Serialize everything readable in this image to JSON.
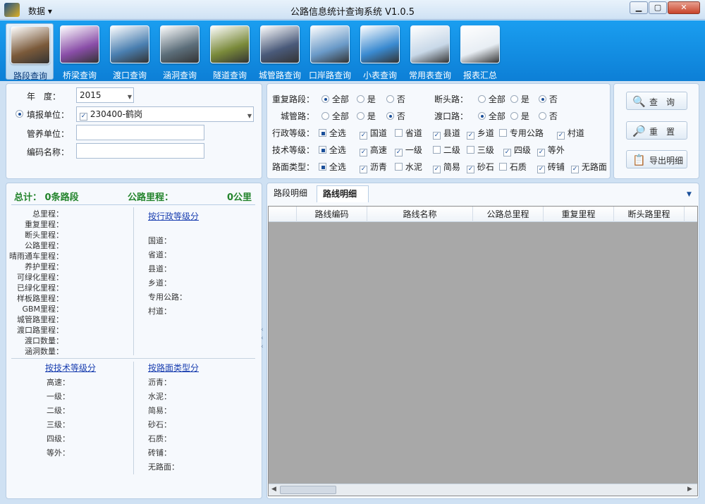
{
  "window": {
    "title": "公路信息统计查询系统 V1.0.5",
    "menu": "数据"
  },
  "ribbon": [
    {
      "label": "路段查询",
      "color": "#7b5a3a",
      "active": true
    },
    {
      "label": "桥梁查询",
      "color": "#8a4ea8"
    },
    {
      "label": "渡口查询",
      "color": "#4a7fb0"
    },
    {
      "label": "涵洞查询",
      "color": "#5c6e7a"
    },
    {
      "label": "隧道查询",
      "color": "#7a8a3a"
    },
    {
      "label": "城管路查询",
      "color": "#4a5a7a"
    },
    {
      "label": "口岸路查询",
      "color": "#6a9ac8"
    },
    {
      "label": "小表查询",
      "color": "#3a8ad0"
    },
    {
      "label": "常用表查询",
      "color": "#c8d8e8"
    },
    {
      "label": "报表汇总",
      "color": "#e8eef4"
    }
  ],
  "form": {
    "year_label": "年　度：",
    "year_value": "2015",
    "unit_label": "填报单位：",
    "unit_value": "230400-鹤岗",
    "mgmt_label": "管养单位：",
    "code_label": "编码名称："
  },
  "filters": {
    "repeat": {
      "label": "重复路段：",
      "opts": [
        "全部",
        "是",
        "否"
      ]
    },
    "deadend": {
      "label": "断头路：",
      "opts": [
        "全部",
        "是",
        "否"
      ]
    },
    "city": {
      "label": "城管路：",
      "opts": [
        "全部",
        "是",
        "否"
      ]
    },
    "ferry": {
      "label": "渡口路：",
      "opts": [
        "全部",
        "是",
        "否"
      ]
    },
    "admin": {
      "label": "行政等级：",
      "opts": [
        "全选",
        "国道",
        "省道",
        "县道",
        "乡道",
        "专用公路",
        "村道"
      ]
    },
    "tech": {
      "label": "技术等级：",
      "opts": [
        "全选",
        "高速",
        "一级",
        "二级",
        "三级",
        "四级",
        "等外"
      ]
    },
    "surface": {
      "label": "路面类型：",
      "opts": [
        "全选",
        "沥青",
        "水泥",
        "简易",
        "砂石",
        "石质",
        "砖铺",
        "无路面"
      ]
    }
  },
  "buttons": {
    "query": "查　询",
    "reset": "重　置",
    "export": "导出明细"
  },
  "summary": {
    "total_label": "总计：",
    "total_value": "0条路段",
    "mileage_label": "公路里程：",
    "mileage_value": "0公里",
    "items": [
      "总里程：",
      "重复里程：",
      "断头里程：",
      "公路里程：",
      "晴雨通车里程：",
      "养护里程：",
      "可绿化里程：",
      "已绿化里程：",
      "样板路里程：",
      "GBM里程：",
      "城管路里程：",
      "渡口路里程：",
      "渡口数量：",
      "涵洞数量："
    ],
    "admin_link": "按行政等级分",
    "admin_items": [
      "国道：",
      "省道：",
      "县道：",
      "乡道：",
      "专用公路：",
      "村道："
    ],
    "tech_link": "按技术等级分",
    "tech_items": [
      "高速：",
      "一级：",
      "二级：",
      "三级：",
      "四级：",
      "等外："
    ],
    "surface_link": "按路面类型分",
    "surface_items": [
      "沥青：",
      "水泥：",
      "简易：",
      "砂石：",
      "石质：",
      "砖铺：",
      "无路面："
    ]
  },
  "tabs": [
    "路段明细",
    "路线明细"
  ],
  "grid": {
    "columns": [
      "路线编码",
      "路线名称",
      "公路总里程",
      "重复里程",
      "断头路里程"
    ]
  }
}
